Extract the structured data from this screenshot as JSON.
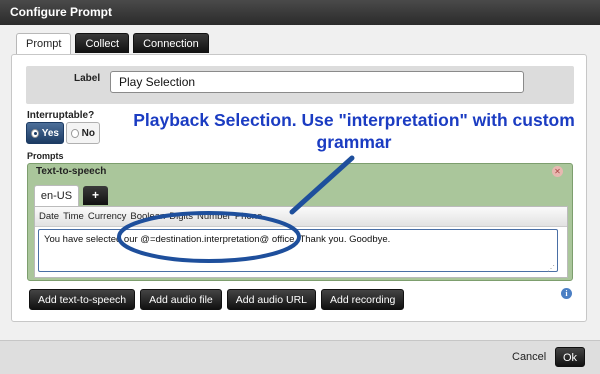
{
  "window": {
    "title": "Configure Prompt"
  },
  "tabs": [
    {
      "label": "Prompt",
      "active": true
    },
    {
      "label": "Collect",
      "active": false
    },
    {
      "label": "Connection",
      "active": false
    }
  ],
  "form": {
    "label_field_label": "Label",
    "label_value": "Play Selection",
    "interruptable_label": "Interruptable?",
    "yes_label": "Yes",
    "no_label": "No",
    "interruptable_selected": "Yes",
    "prompts_label": "Prompts"
  },
  "tts_panel": {
    "header": "Text-to-speech",
    "language_tab": "en-US",
    "add_tab_label": "+",
    "toolbar_items": [
      "Date",
      "Time",
      "Currency",
      "Boolean",
      "Digits",
      "Number",
      "Phone"
    ],
    "text": "You have selected our @=destination.interpretation@ office.  Thank you.  Goodbye."
  },
  "add_buttons": [
    "Add text-to-speech",
    "Add audio file",
    "Add audio URL",
    "Add recording"
  ],
  "footer": {
    "cancel_label": "Cancel",
    "ok_label": "Ok"
  },
  "annotation": {
    "text": "Playback Selection.  Use \"interpretation\" with custom grammar",
    "color": "#1b3cc2"
  },
  "colors": {
    "titlebar": "#2b2b2b",
    "tts_panel_bg": "#aac69b",
    "yes_toggle": "#1c3b63",
    "annotation_ink": "#1b3cc2"
  }
}
